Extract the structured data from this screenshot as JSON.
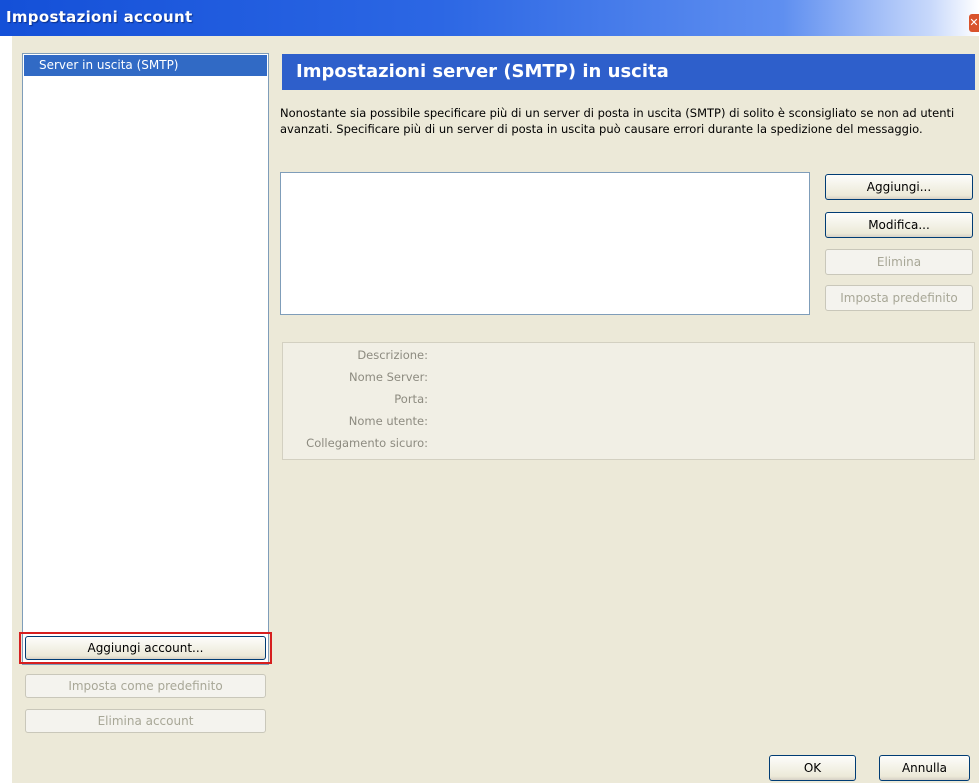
{
  "window": {
    "title": "Impostazioni account",
    "close_glyph": "✕"
  },
  "left_panel": {
    "items": [
      {
        "label": "Server in uscita (SMTP)",
        "selected": true
      }
    ]
  },
  "left_buttons": {
    "add_account": "Aggiungi account...",
    "set_default": "Imposta come predefinito",
    "delete_account": "Elimina account"
  },
  "main": {
    "header": "Impostazioni server (SMTP) in uscita",
    "description": "Nonostante sia possibile specificare più di un server di posta in uscita (SMTP) di solito è sconsigliato se non ad utenti avanzati. Specificare più di un server di posta in uscita può causare errori durante la spedizione del messaggio.",
    "buttons": {
      "add": "Aggiungi...",
      "edit": "Modifica...",
      "delete": "Elimina",
      "set_default": "Imposta predefinito"
    },
    "details": {
      "description_label": "Descrizione:",
      "server_name_label": "Nome Server:",
      "port_label": "Porta:",
      "username_label": "Nome utente:",
      "secure_connection_label": "Collegamento sicuro:"
    }
  },
  "footer": {
    "ok": "OK",
    "cancel": "Annulla"
  },
  "colors": {
    "titlebar": "#2c67e4",
    "header_bar": "#2e5fcb",
    "selection": "#316ac5",
    "dialog_bg": "#ece9d8",
    "highlight": "#d61f1f"
  }
}
